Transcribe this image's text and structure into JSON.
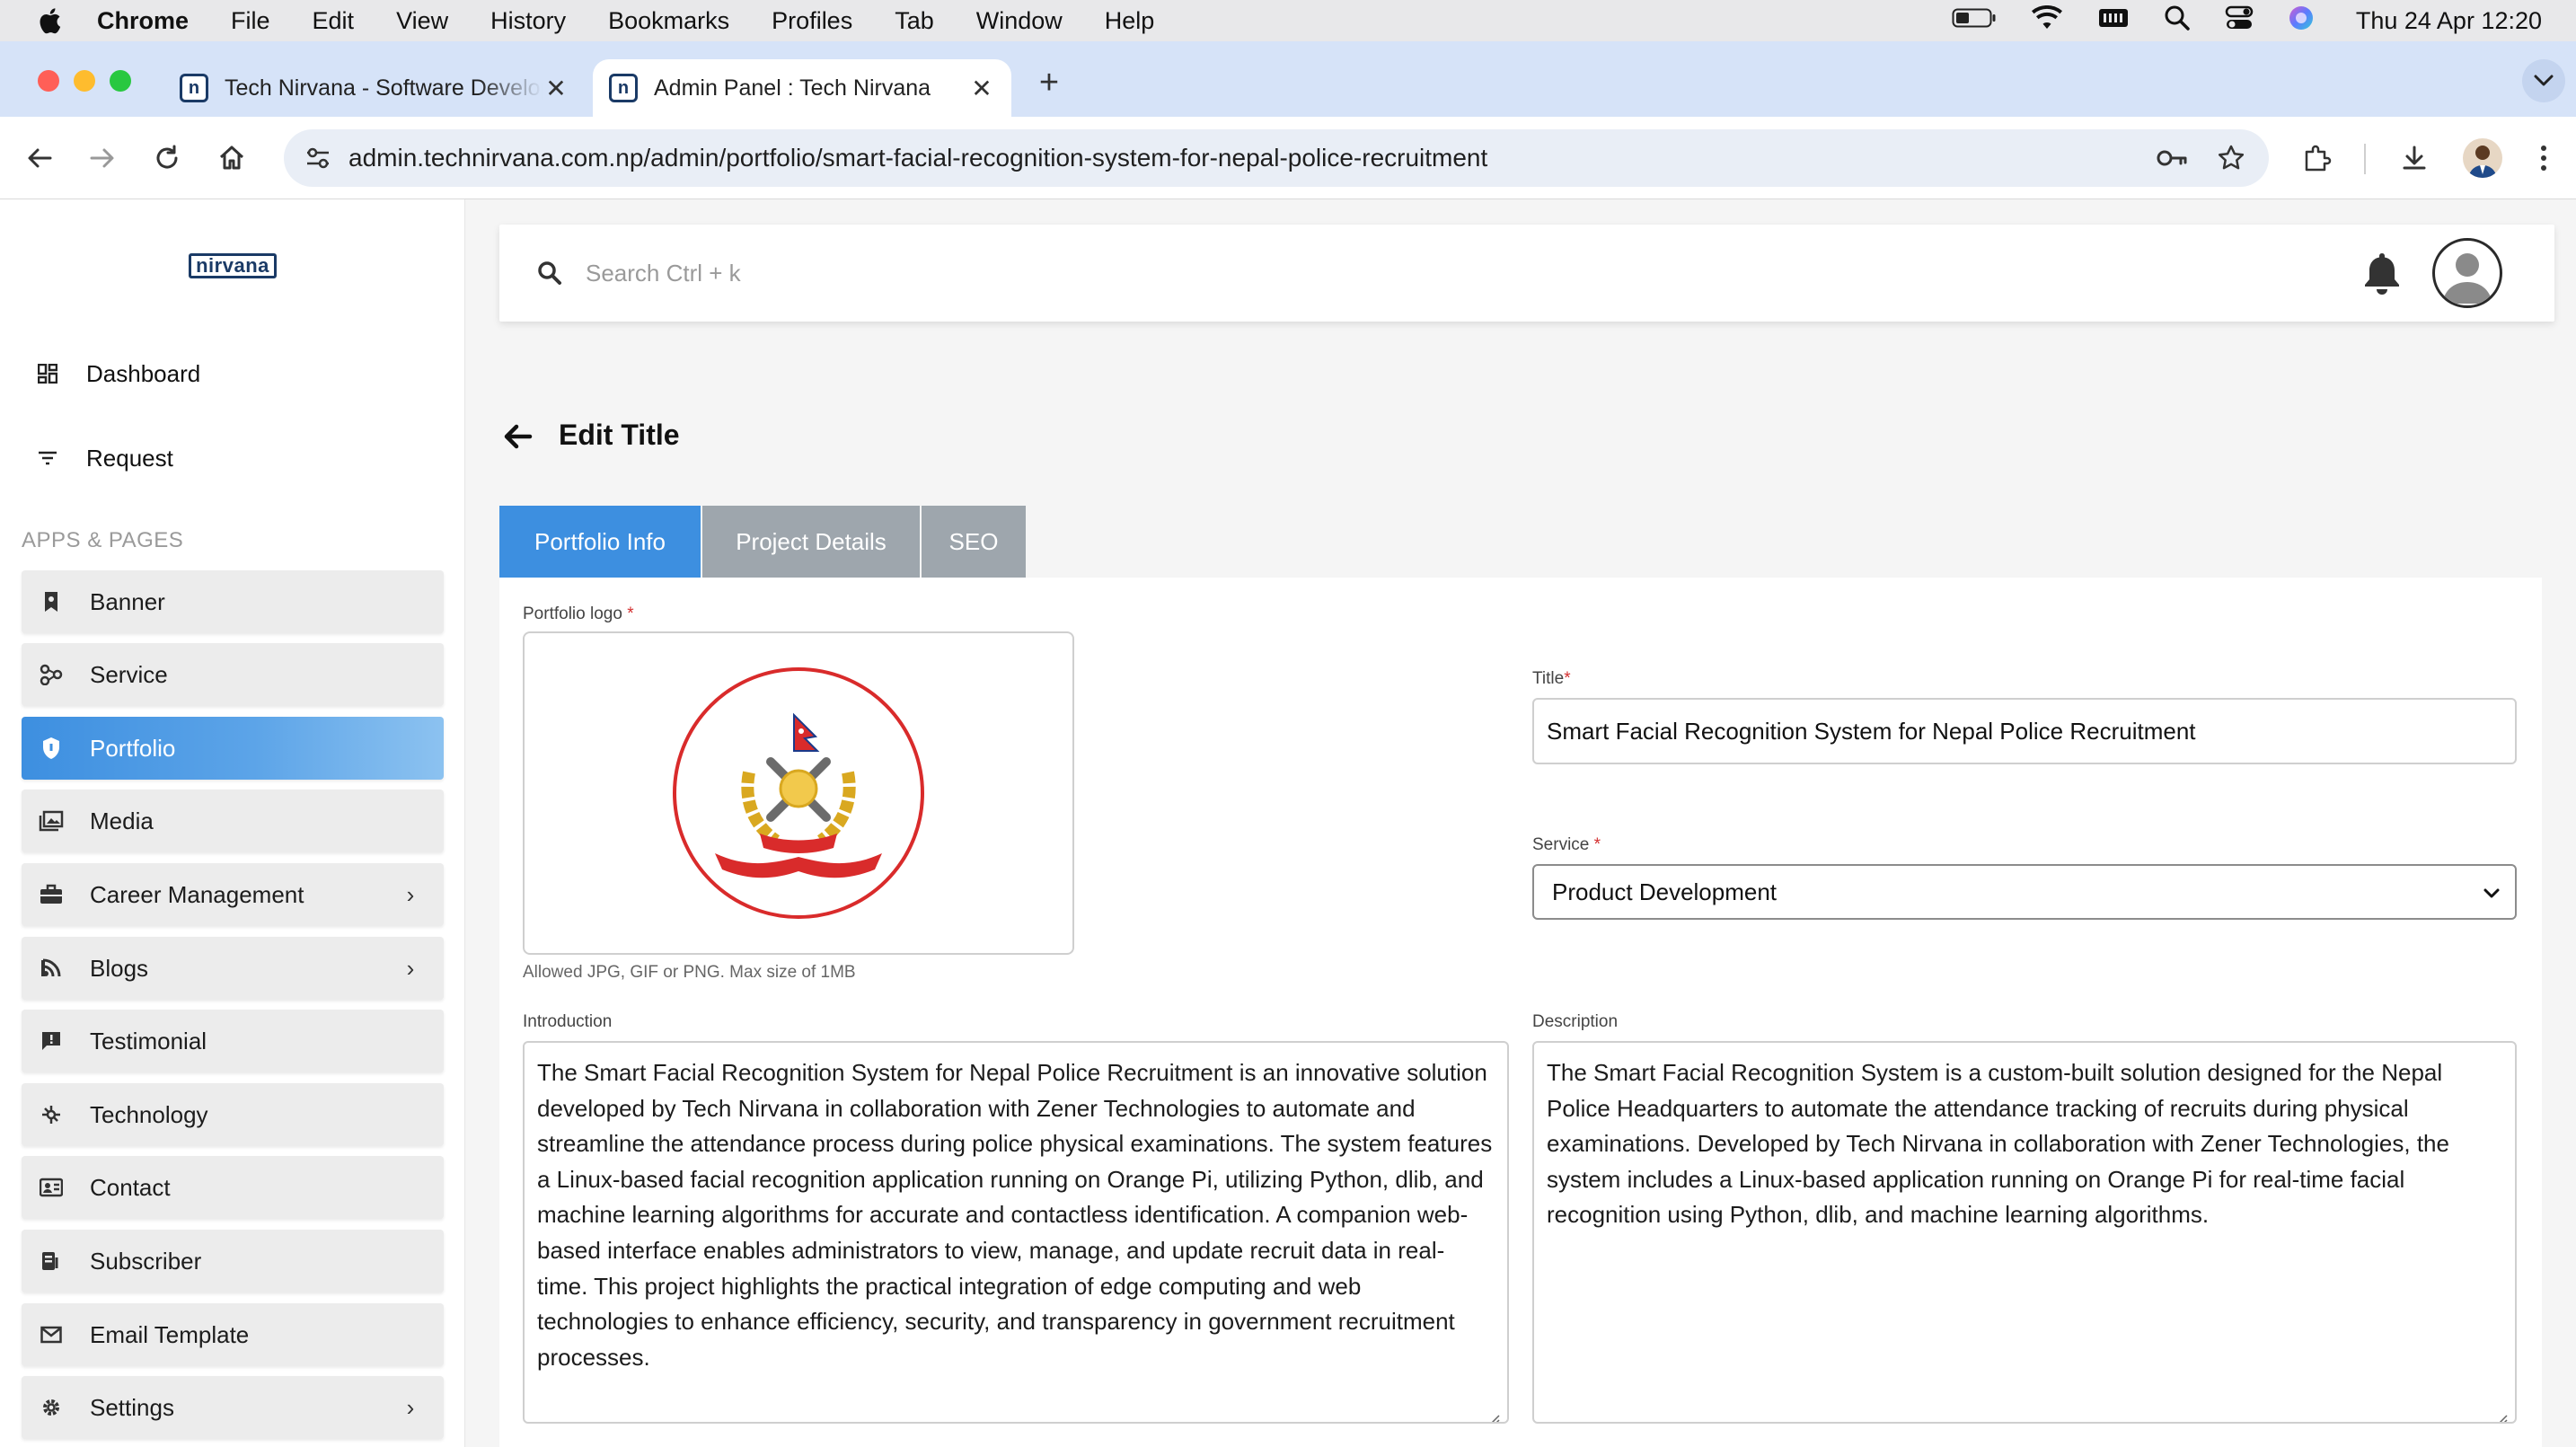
{
  "menubar": {
    "app": "Chrome",
    "items": [
      "File",
      "Edit",
      "View",
      "History",
      "Bookmarks",
      "Profiles",
      "Tab",
      "Window",
      "Help"
    ],
    "clock": "Thu 24 Apr  12:20"
  },
  "browser": {
    "tabs": [
      {
        "title": "Tech Nirvana - Software Development",
        "favicon": "n",
        "close": "✕"
      },
      {
        "title": "Admin Panel : Tech Nirvana",
        "favicon": "n",
        "close": "✕"
      }
    ],
    "new_tab": "+",
    "url": "admin.technirvana.com.np/admin/portfolio/smart-facial-recognition-system-for-nepal-police-recruitment"
  },
  "sidebar": {
    "brand": "nirvana",
    "top_links": [
      {
        "label": "Dashboard",
        "icon": "dashboard-icon"
      },
      {
        "label": "Request",
        "icon": "filter-icon"
      }
    ],
    "section_label": "APPS & PAGES",
    "items": [
      {
        "label": "Banner",
        "icon": "banner-icon"
      },
      {
        "label": "Service",
        "icon": "service-icon"
      },
      {
        "label": "Portfolio",
        "icon": "shield-icon"
      },
      {
        "label": "Media",
        "icon": "media-icon"
      },
      {
        "label": "Career Management",
        "icon": "briefcase-icon",
        "chevron": "›"
      },
      {
        "label": "Blogs",
        "icon": "blogs-icon",
        "chevron": "›"
      },
      {
        "label": "Testimonial",
        "icon": "testimonial-icon"
      },
      {
        "label": "Technology",
        "icon": "technology-icon"
      },
      {
        "label": "Contact",
        "icon": "contact-icon"
      },
      {
        "label": "Subscriber",
        "icon": "subscriber-icon"
      },
      {
        "label": "Email Template",
        "icon": "email-icon"
      },
      {
        "label": "Settings",
        "icon": "settings-icon",
        "chevron": "›"
      }
    ],
    "active_item": "Portfolio"
  },
  "topbar": {
    "search_placeholder": "Search Ctrl + k"
  },
  "page": {
    "title": "Edit Title",
    "tabs": [
      "Portfolio Info",
      "Project Details",
      "SEO"
    ],
    "active_tab": "Portfolio Info"
  },
  "form": {
    "logo_label": "Portfolio logo",
    "logo_hint": "Allowed JPG, GIF or PNG. Max size of 1MB",
    "title_label": "Title",
    "title_value": "Smart Facial Recognition System for Nepal Police Recruitment",
    "service_label": "Service",
    "service_value": "Product Development",
    "introduction_label": "Introduction",
    "introduction_value": "The Smart Facial Recognition System for Nepal Police Recruitment is an innovative solution developed by Tech Nirvana in collaboration with Zener Technologies to automate and streamline the attendance process during police physical examinations. The system features a Linux-based facial recognition application running on Orange Pi, utilizing Python, dlib, and machine learning algorithms for accurate and contactless identification. A companion web-based interface enables administrators to view, manage, and update recruit data in real-time. This project highlights the practical integration of edge computing and web technologies to enhance efficiency, security, and transparency in government recruitment processes.",
    "description_label": "Description",
    "description_value": "The Smart Facial Recognition System is a custom-built solution designed for the Nepal Police Headquarters to automate the attendance tracking of recruits during physical examinations. Developed by Tech Nirvana in collaboration with Zener Technologies, the system includes a Linux-based application running on Orange Pi for real-time facial recognition using Python, dlib, and machine learning algorithms.",
    "required_mark": "*"
  },
  "colors": {
    "accent": "#3d8fe0",
    "tab_inactive": "#9ea6ad",
    "required": "#d32f2f",
    "brand": "#1a3a66"
  }
}
